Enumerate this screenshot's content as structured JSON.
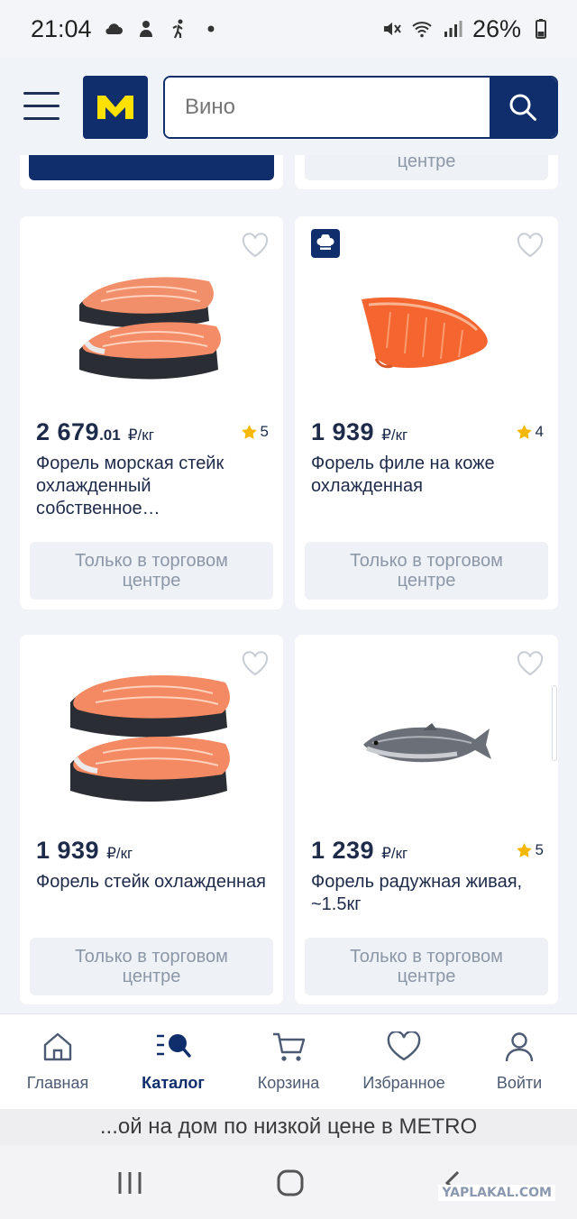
{
  "status_bar": {
    "time": "21:04",
    "battery": "26%"
  },
  "header": {
    "logo_letter": "M",
    "search_placeholder": "Вино",
    "search_value": ""
  },
  "top_row": {
    "right_button_line2": "центре"
  },
  "products": [
    {
      "price_main": "2 679",
      "price_decimal": ".01",
      "unit": "₽/кг",
      "rating": "5",
      "has_rating": true,
      "title": "Форель морская стейк охлажденный собственное…",
      "availability": "Только в торговом центре",
      "favorited": false,
      "has_chef_badge": false
    },
    {
      "price_main": "1 939",
      "price_decimal": "",
      "unit": "₽/кг",
      "rating": "4",
      "has_rating": true,
      "title": "Форель филе на коже охлажденная",
      "availability": "Только в торговом центре",
      "favorited": false,
      "has_chef_badge": true
    },
    {
      "price_main": "1 939",
      "price_decimal": "",
      "unit": "₽/кг",
      "rating": "",
      "has_rating": false,
      "title": "Форель стейк охлажденная",
      "availability": "Только в торговом центре",
      "favorited": false,
      "has_chef_badge": false
    },
    {
      "price_main": "1 239",
      "price_decimal": "",
      "unit": "₽/кг",
      "rating": "5",
      "has_rating": true,
      "title": "Форель радужная живая, ~1.5кг",
      "availability": "Только в торговом центре",
      "favorited": false,
      "has_chef_badge": false
    }
  ],
  "availability_line1": "Только в торговом",
  "availability_line2": "центре",
  "bottom_nav": {
    "items": [
      {
        "label": "Главная",
        "icon": "home-icon",
        "active": false
      },
      {
        "label": "Каталог",
        "icon": "catalog-search-icon",
        "active": true
      },
      {
        "label": "Корзина",
        "icon": "cart-icon",
        "active": false
      },
      {
        "label": "Избранное",
        "icon": "heart-icon",
        "active": false
      },
      {
        "label": "Войти",
        "icon": "user-icon",
        "active": false
      }
    ]
  },
  "url_banner": "...ой на дом по низкой цене в METRO",
  "watermark": "YAPLAKAL.COM",
  "colors": {
    "brand_blue": "#102e6b",
    "brand_yellow": "#ffe100",
    "star": "#f5b800",
    "muted_button": "#eef1f5"
  }
}
